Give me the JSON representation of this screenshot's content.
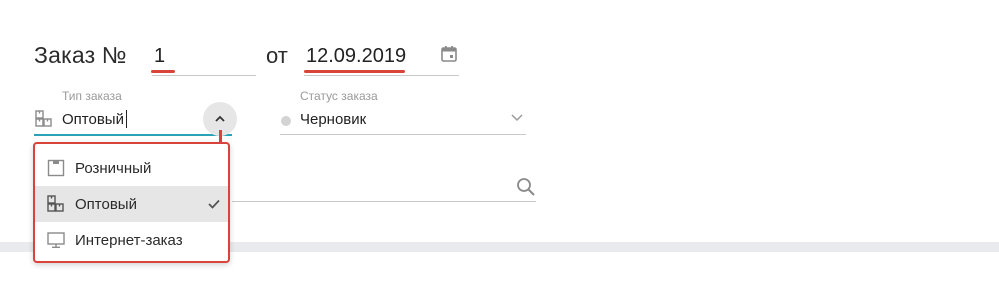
{
  "header": {
    "order_label": "Заказ №",
    "order_number": "1",
    "from_label": "от",
    "order_date": "12.09.2019"
  },
  "order_type": {
    "label": "Тип заказа",
    "value": "Оптовый",
    "icon": "wholesale-icon"
  },
  "order_status": {
    "label": "Статус заказа",
    "value": "Черновик",
    "status_color": "#d3d3d3"
  },
  "dropdown": {
    "items": [
      {
        "label": "Розничный",
        "icon": "retail-icon",
        "selected": false
      },
      {
        "label": "Оптовый",
        "icon": "wholesale-icon",
        "selected": true
      },
      {
        "label": "Интернет-заказ",
        "icon": "monitor-icon",
        "selected": false
      }
    ]
  },
  "colors": {
    "accent": "#2aa3b8",
    "highlight": "#d9443a",
    "selected_bg": "#e6e6e6"
  }
}
